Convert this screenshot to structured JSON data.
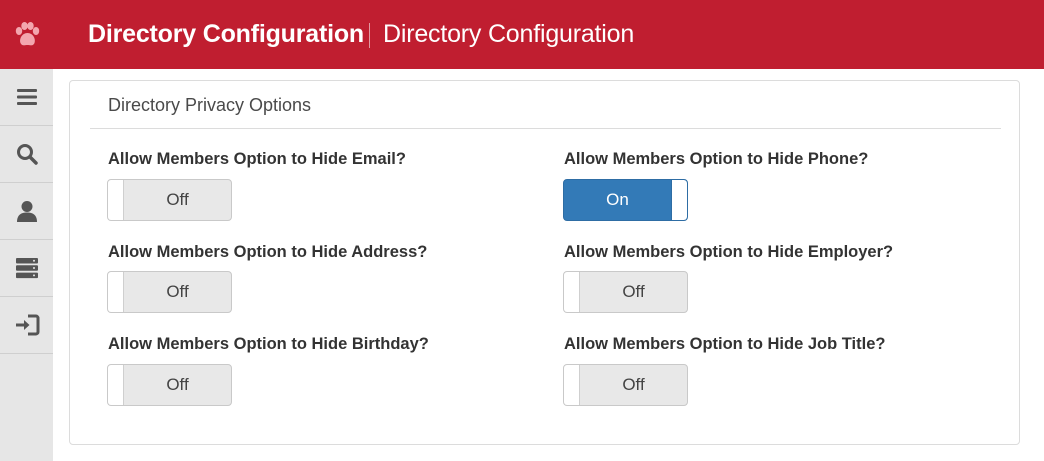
{
  "header": {
    "title": "Directory Configuration",
    "subtitle": "Directory Configuration",
    "background": "#c01e30"
  },
  "sidebar": {
    "items": [
      {
        "icon": "menu-icon"
      },
      {
        "icon": "search-icon"
      },
      {
        "icon": "user-icon"
      },
      {
        "icon": "server-icon"
      },
      {
        "icon": "sign-in-icon"
      }
    ]
  },
  "panel": {
    "title": "Directory Privacy Options",
    "options": [
      {
        "label": "Allow Members Option to Hide Email?",
        "state": "Off"
      },
      {
        "label": "Allow Members Option to Hide Phone?",
        "state": "On"
      },
      {
        "label": "Allow Members Option to Hide Address?",
        "state": "Off"
      },
      {
        "label": "Allow Members Option to Hide Employer?",
        "state": "Off"
      },
      {
        "label": "Allow Members Option to Hide Birthday?",
        "state": "Off"
      },
      {
        "label": "Allow Members Option to Hide Job Title?",
        "state": "Off"
      }
    ]
  },
  "colors": {
    "toggle_on": "#337ab7",
    "toggle_off": "#e8e8e8"
  }
}
